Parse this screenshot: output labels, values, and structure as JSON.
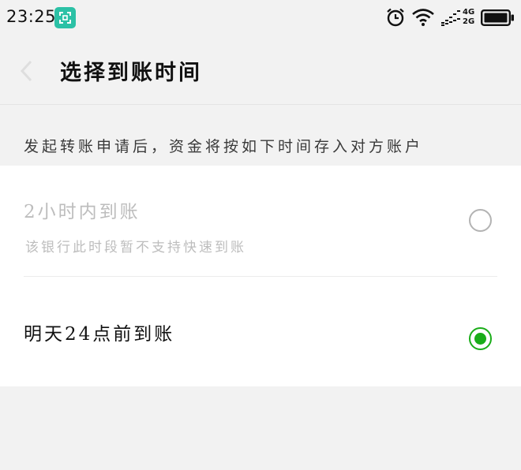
{
  "status_bar": {
    "time": "23:25",
    "network_top": "4G",
    "network_bottom": "2G"
  },
  "nav": {
    "title": "选择到账时间"
  },
  "hint": "发起转账申请后，资金将按如下时间存入对方账户",
  "options": [
    {
      "title": "2小时内到账",
      "subtitle": "该银行此时段暂不支持快速到账",
      "selected": false,
      "enabled": false
    },
    {
      "title": "明天24点前到账",
      "selected": true,
      "enabled": true
    }
  ],
  "colors": {
    "accent_green": "#1aad19",
    "page_background": "#f2f2f2",
    "panel_background": "#ffffff",
    "disabled_text": "#bdbdbd",
    "scan_icon": "#2cc1a6"
  },
  "icons": [
    "scan-app-icon",
    "alarm-clock-icon",
    "wifi-icon",
    "signal-icon",
    "battery-icon",
    "back-arrow-icon"
  ]
}
